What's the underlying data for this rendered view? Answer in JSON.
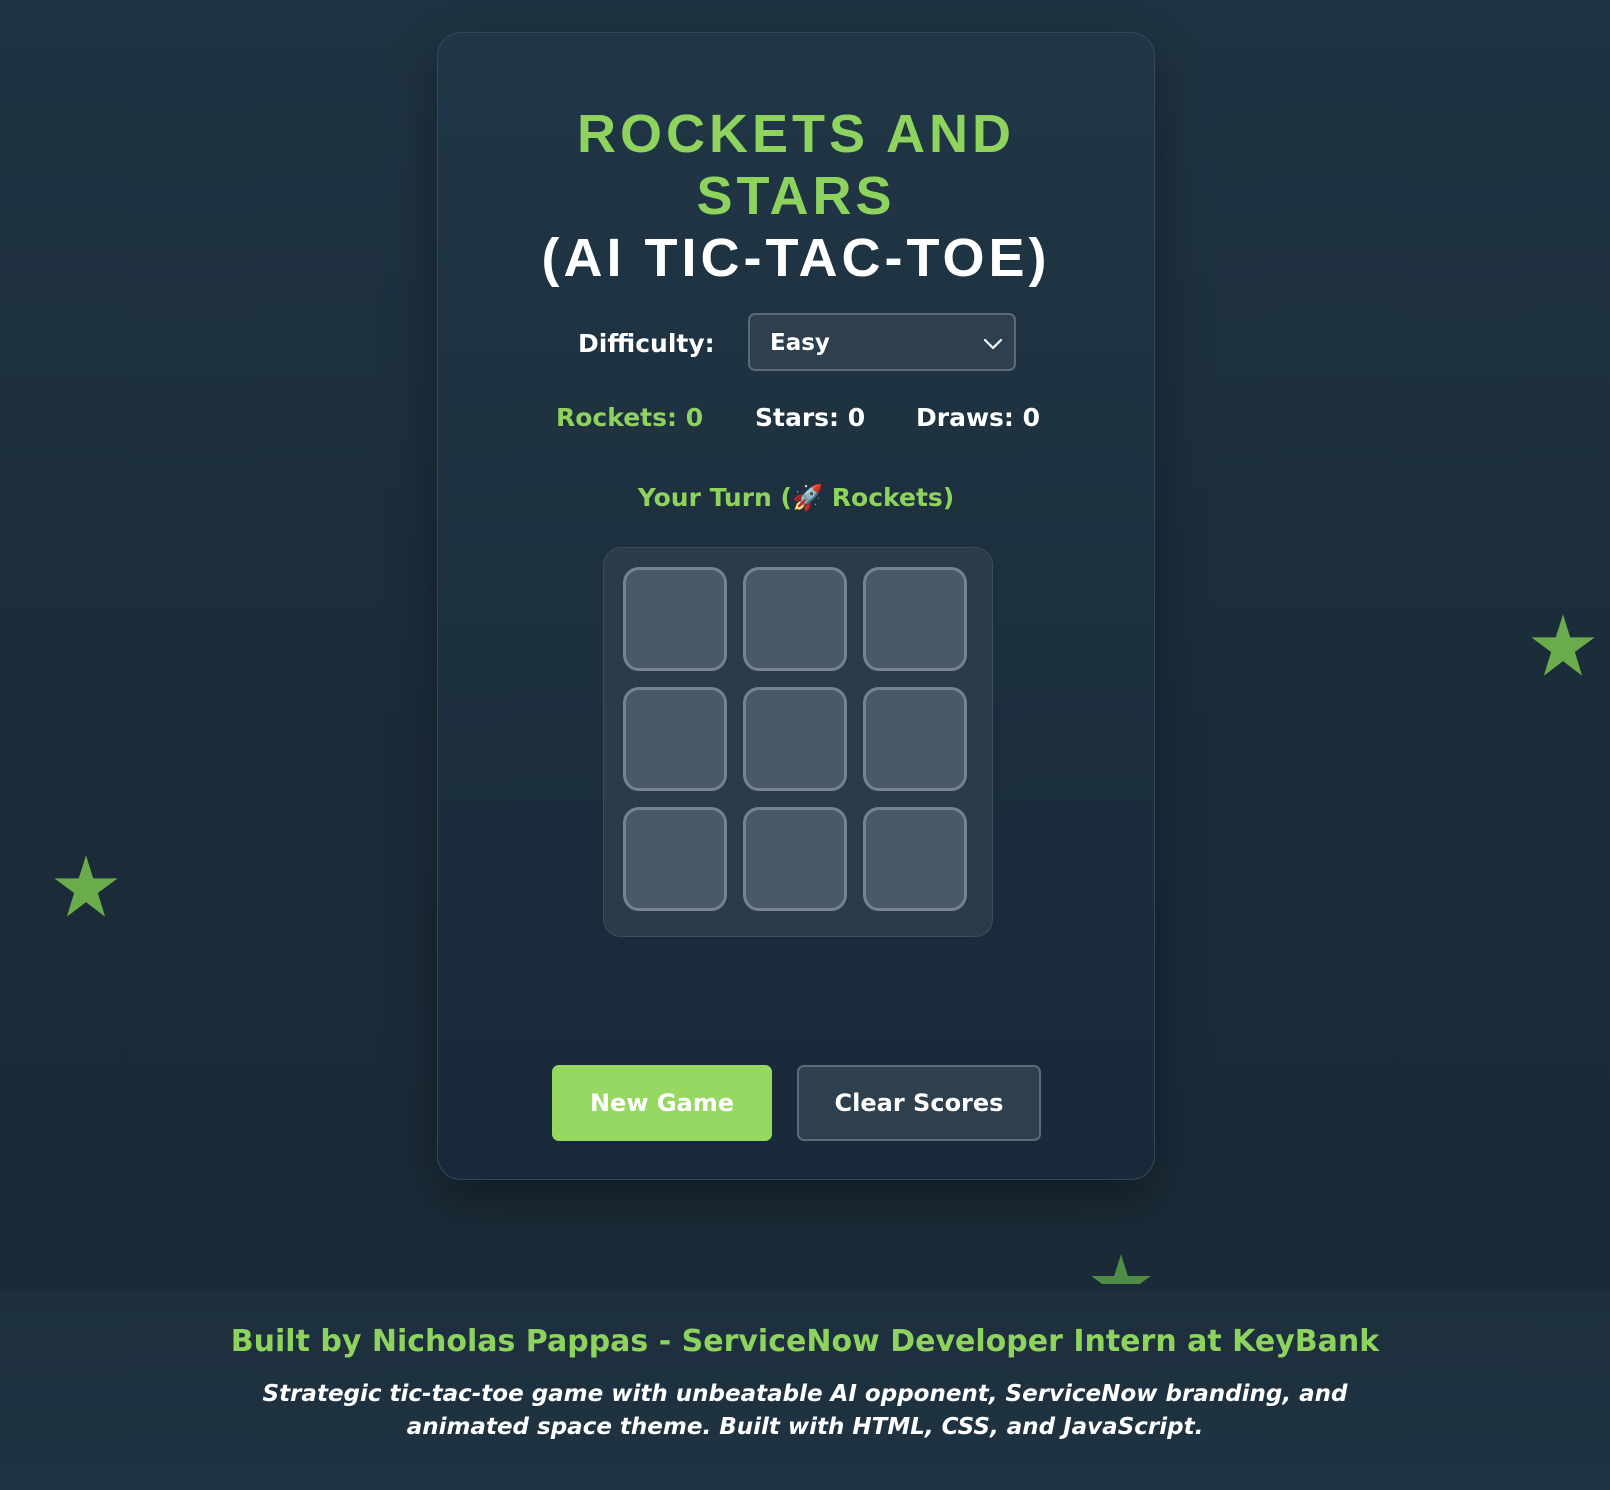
{
  "header": {
    "title_line1": "ROCKETS AND STARS",
    "title_line2": "(AI TIC-TAC-TOE)"
  },
  "difficulty": {
    "label": "Difficulty:",
    "selected": "Easy"
  },
  "scores": {
    "rockets": "Rockets: 0",
    "stars": "Stars: 0",
    "draws": "Draws: 0"
  },
  "status": {
    "turn": "Your Turn (🚀 Rockets)"
  },
  "board": {
    "cells": [
      "",
      "",
      "",
      "",
      "",
      "",
      "",
      "",
      ""
    ]
  },
  "buttons": {
    "new_game": "New Game",
    "clear_scores": "Clear Scores"
  },
  "footer": {
    "credit": "Built by Nicholas Pappas - ServiceNow Developer Intern at KeyBank",
    "description": "Strategic tic-tac-toe game with unbeatable AI opponent, ServiceNow branding, and animated space theme. Built with HTML, CSS, and JavaScript."
  },
  "colors": {
    "accent_green": "#8fd35f",
    "button_green": "#96d861",
    "background": "#1f3342",
    "cell": "#4a5966"
  }
}
